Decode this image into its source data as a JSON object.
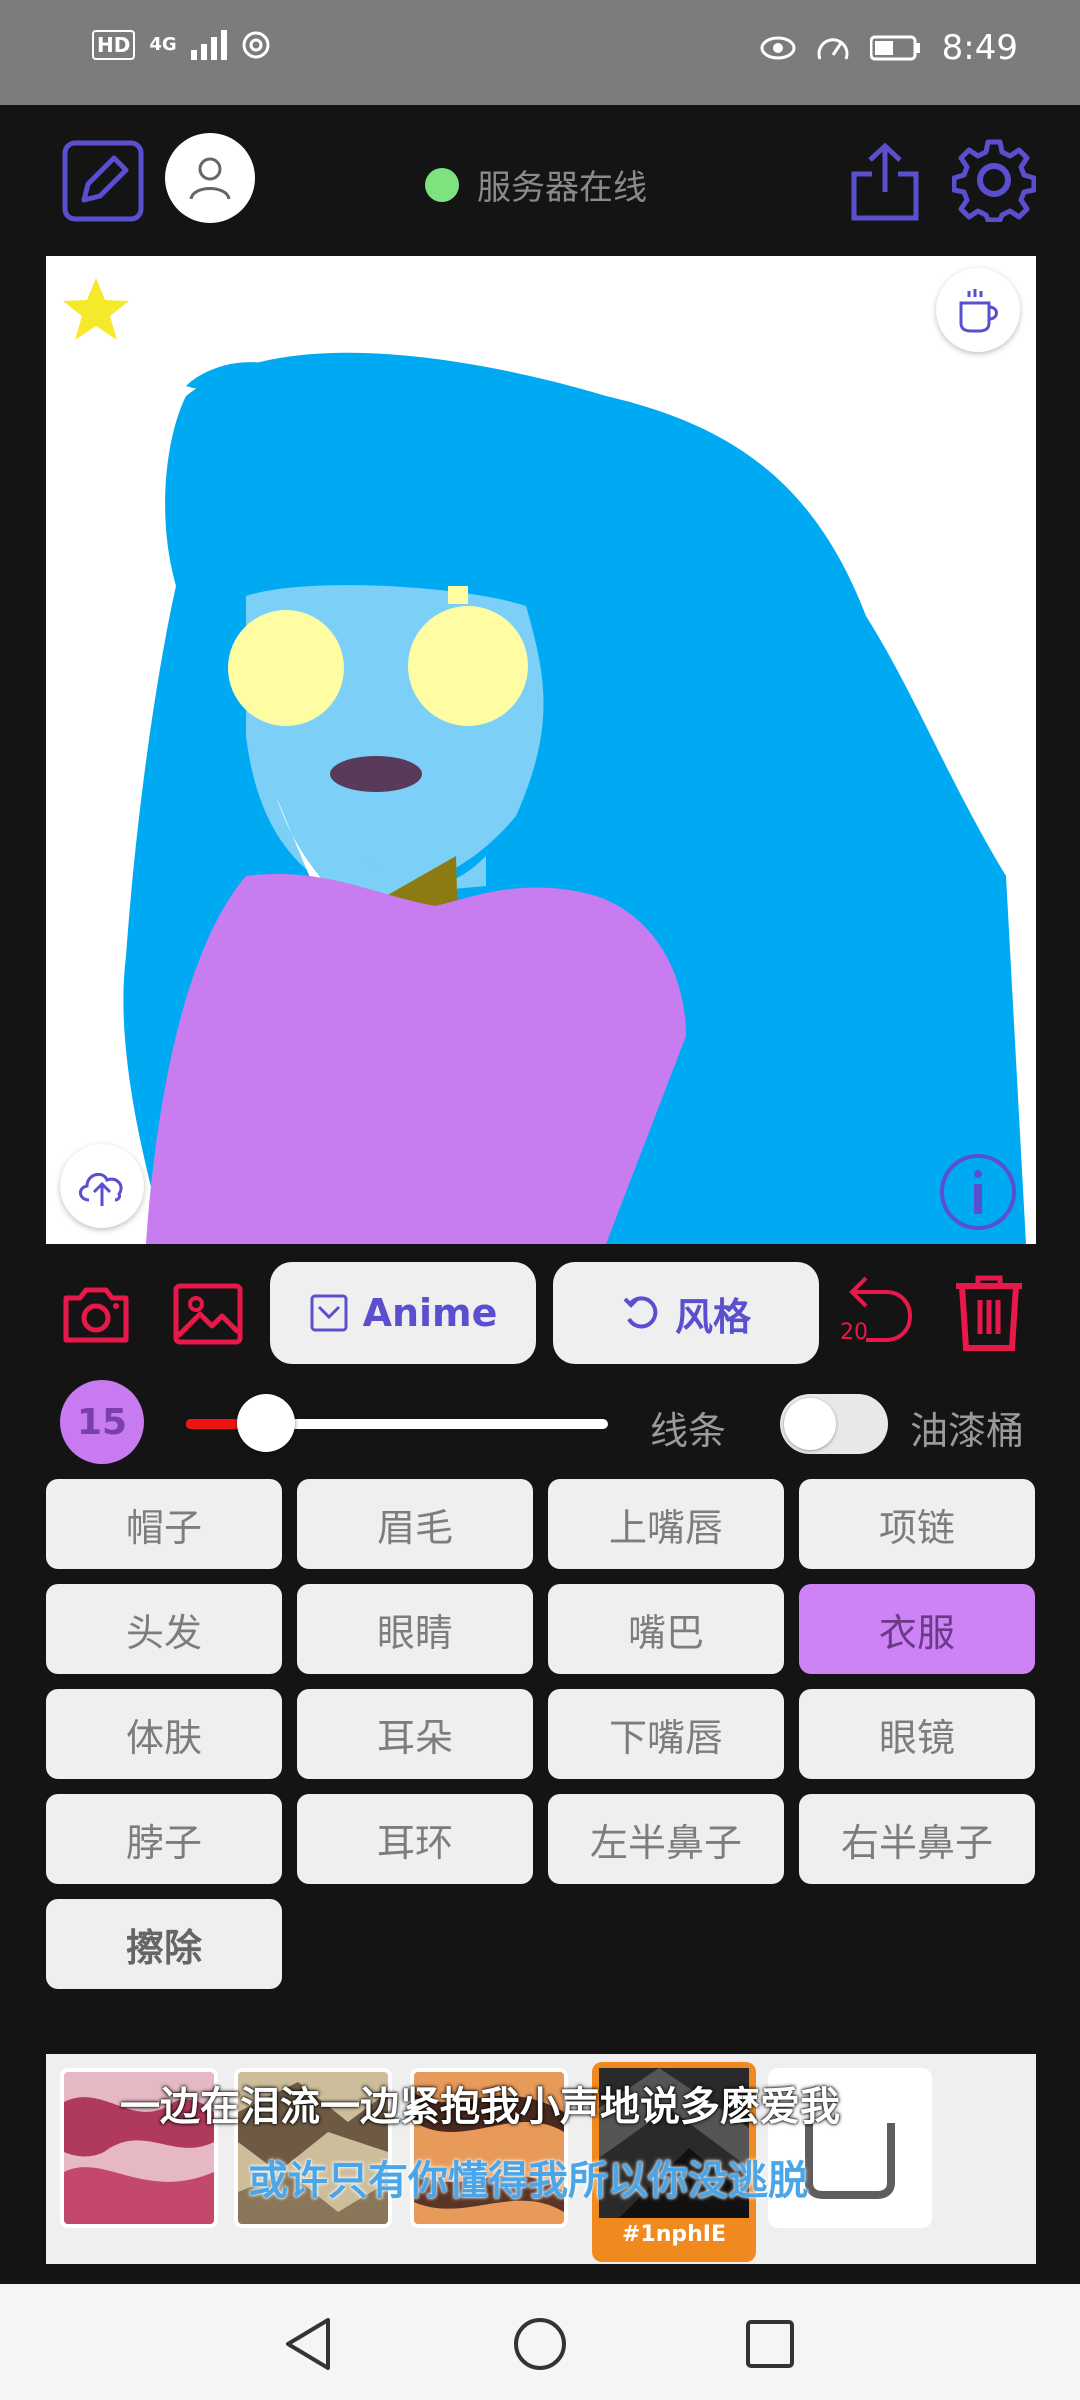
{
  "status_bar": {
    "time": "8:49",
    "hd": "HD",
    "network": "4G"
  },
  "header": {
    "server_status": "服务器在线",
    "status_color": "#7ee37e"
  },
  "toolbar": {
    "anime_label": "Anime",
    "style_label": "风格",
    "undo_count": "20"
  },
  "brush": {
    "size": "15",
    "line_label": "线条",
    "bucket_label": "油漆桶",
    "slider_fraction": 0.19,
    "bucket_enabled": false
  },
  "parts": [
    "帽子",
    "眉毛",
    "上嘴唇",
    "项链",
    "头发",
    "眼睛",
    "嘴巴",
    "衣服",
    "体肤",
    "耳朵",
    "下嘴唇",
    "眼镜",
    "脖子",
    "耳环",
    "左半鼻子",
    "右半鼻子",
    "擦除"
  ],
  "selected_part": "衣服",
  "gallery": {
    "selected_tag": "#1nphIE",
    "lyric_line1": "一边在泪流一边紧抱我小声地说多麽爱我",
    "lyric_line2": "或许只有你懂得我所以你没逃脱"
  },
  "colors": {
    "accent": "#5a4fcf",
    "danger": "#e8184a",
    "selected": "#cd82f6"
  }
}
